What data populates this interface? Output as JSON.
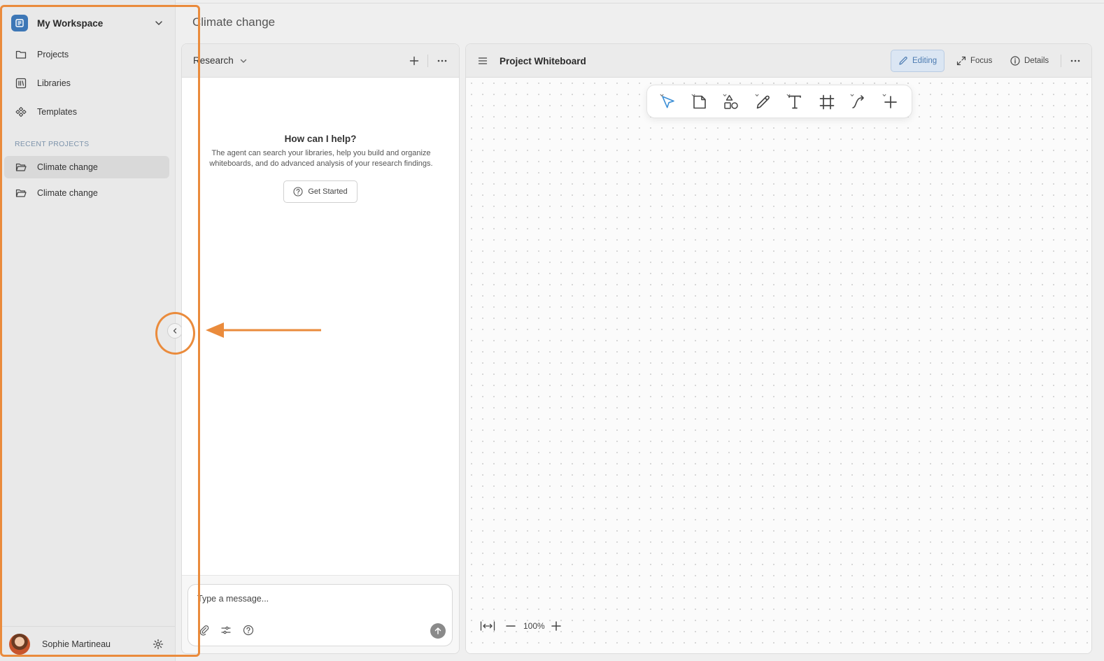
{
  "workspace": {
    "title": "My Workspace",
    "logo_icon": "workspace-logo-icon"
  },
  "sidebar": {
    "nav": [
      {
        "label": "Projects",
        "icon": "folder-icon"
      },
      {
        "label": "Libraries",
        "icon": "library-icon"
      },
      {
        "label": "Templates",
        "icon": "templates-icon"
      }
    ],
    "recent_label": "RECENT PROJECTS",
    "recent": [
      {
        "label": "Climate change",
        "icon": "folder-open-icon",
        "active": true
      },
      {
        "label": "Climate change",
        "icon": "folder-open-icon",
        "active": false
      }
    ]
  },
  "user": {
    "name": "Sophie Martineau"
  },
  "page": {
    "title": "Climate change"
  },
  "research": {
    "title": "Research",
    "help_title": "How can I help?",
    "help_text": "The agent can search your libraries, help you build and organize whiteboards, and do advanced analysis of your research findings.",
    "get_started": "Get Started",
    "composer_placeholder": "Type a message..."
  },
  "whiteboard": {
    "title": "Project Whiteboard",
    "modes": {
      "editing": "Editing",
      "focus": "Focus",
      "details": "Details"
    },
    "tools": [
      "select-icon",
      "note-icon",
      "shapes-icon",
      "pen-icon",
      "text-icon",
      "frame-icon",
      "connector-icon",
      "add-icon"
    ],
    "zoom": "100%"
  },
  "colors": {
    "accent": "#3d77b6",
    "annotation": "#ea8b3c",
    "editing_bg": "#dbe6f3"
  }
}
